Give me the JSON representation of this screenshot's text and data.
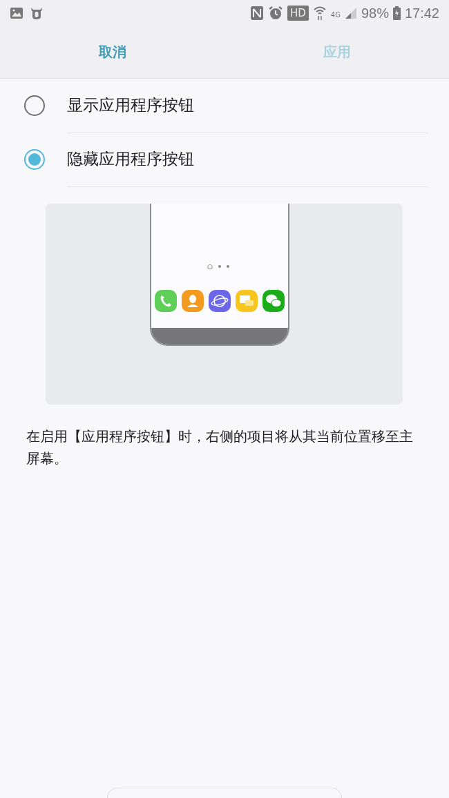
{
  "status_bar": {
    "hd_badge": "HD",
    "network": "4G",
    "battery": "98%",
    "time": "17:42"
  },
  "header": {
    "cancel": {
      "label": "取消",
      "disabled": false
    },
    "apply": {
      "label": "应用",
      "disabled": true
    }
  },
  "options": [
    {
      "label": "显示应用程序按钮",
      "selected": false
    },
    {
      "label": "隐藏应用程序按钮",
      "selected": true
    }
  ],
  "description": "在启用【应用程序按钮】时，右侧的项目将从其当前位置移至主屏幕。"
}
